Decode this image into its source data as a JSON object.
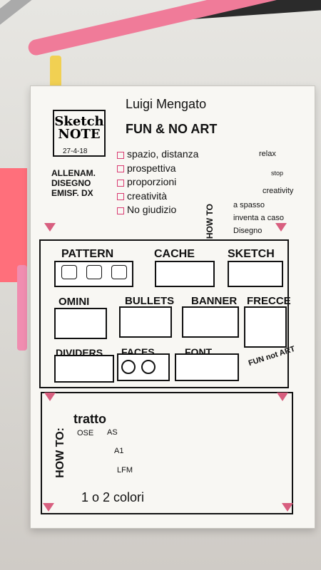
{
  "header": {
    "name": "Luigi Mengato",
    "tag": "FUN & NO ART"
  },
  "title": {
    "main": "Sketch NOTE",
    "date": "27-4-18"
  },
  "side": {
    "left": [
      "ALLENAM.",
      "DISEGNO",
      "EMISF. DX"
    ],
    "list": [
      "spazio, distanza",
      "prospettiva",
      "proporzioni",
      "creatività",
      "No giudizio"
    ],
    "how_to": [
      "a spasso",
      "inventa a caso",
      "Disegno"
    ]
  },
  "sections": {
    "top": [
      "PATTERN",
      "CACHE",
      "SKETCH"
    ],
    "middle": [
      "OMINI",
      "BULLETS",
      "BANNER",
      "FRECCE"
    ],
    "bottom": [
      "DIVIDERS",
      "FACES",
      "FONT"
    ],
    "badge": "FUN not ART"
  },
  "bottom_panel": {
    "title": "HOW TO:",
    "items": [
      "tratto",
      "OSE",
      "AS",
      "A1",
      "LFM"
    ],
    "note": "1 o 2 colori"
  },
  "labels": {
    "relax": "relax",
    "creativity": "creativity",
    "stop": "stop"
  }
}
